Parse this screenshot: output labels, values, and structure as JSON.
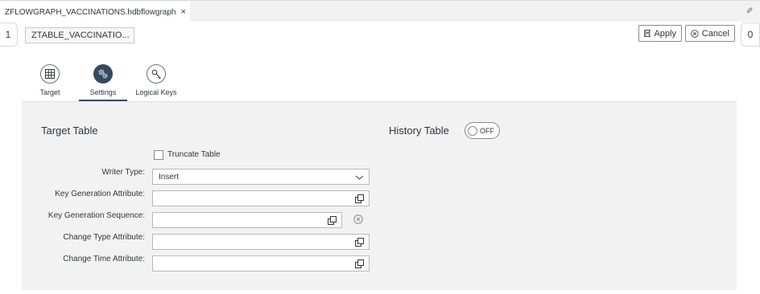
{
  "tabbar": {
    "tab_title": "ZFLOWGRAPH_VACCINATIONS.hdbflowgraph",
    "close_glyph": "×",
    "pin_glyph": "✐"
  },
  "toolbar": {
    "left_count": "1",
    "right_count": "0",
    "node_name": "ZTABLE_VACCINATIO...",
    "apply_label": "Apply",
    "cancel_label": "Cancel"
  },
  "tabs": [
    {
      "label": "Target",
      "icon": "table-grid-icon",
      "active": false
    },
    {
      "label": "Settings",
      "icon": "settings-gear-icon",
      "active": true
    },
    {
      "label": "Logical Keys",
      "icon": "key-icon",
      "active": false
    }
  ],
  "settings": {
    "target_title": "Target Table",
    "history_title": "History Table",
    "history_toggle": "OFF",
    "truncate_label": "Truncate Table",
    "truncate_checked": false,
    "fields": [
      {
        "label": "Writer Type:",
        "value": "Insert",
        "kind": "select"
      },
      {
        "label": "Key Generation Attribute:",
        "value": "",
        "kind": "value-help"
      },
      {
        "label": "Key Generation Sequence:",
        "value": "",
        "kind": "value-help-clearable"
      },
      {
        "label": "Change Type Attribute:",
        "value": "",
        "kind": "value-help"
      },
      {
        "label": "Change Time Attribute:",
        "value": "",
        "kind": "value-help"
      }
    ]
  },
  "colors": {
    "accent": "#354a5f",
    "panel_bg": "#f2f2f2",
    "border": "#b8b8b8"
  }
}
